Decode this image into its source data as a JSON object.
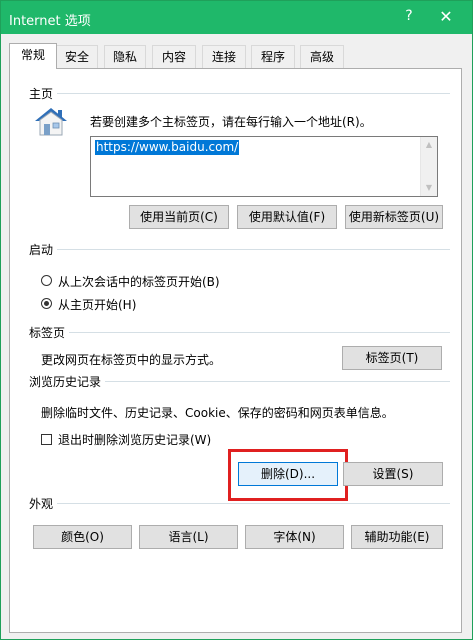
{
  "window": {
    "title": "Internet 选项",
    "help": "?",
    "close": "✕"
  },
  "tabs": [
    "常规",
    "安全",
    "隐私",
    "内容",
    "连接",
    "程序",
    "高级"
  ],
  "homepage": {
    "title": "主页",
    "description": "若要创建多个主标签页，请在每行输入一个地址(R)。",
    "url": "https://www.baidu.com/",
    "buttons": {
      "use_current": "使用当前页(C)",
      "use_default": "使用默认值(F)",
      "use_new_tab": "使用新标签页(U)"
    }
  },
  "startup": {
    "title": "启动",
    "options": [
      {
        "label": "从上次会话中的标签页开始(B)",
        "selected": false
      },
      {
        "label": "从主页开始(H)",
        "selected": true
      }
    ]
  },
  "tabs_group": {
    "title": "标签页",
    "description": "更改网页在标签页中的显示方式。",
    "button": "标签页(T)"
  },
  "history": {
    "title": "浏览历史记录",
    "description": "删除临时文件、历史记录、Cookie、保存的密码和网页表单信息。",
    "checkbox": "退出时删除浏览历史记录(W)",
    "delete_button": "删除(D)...",
    "settings_button": "设置(S)"
  },
  "appearance": {
    "title": "外观",
    "buttons": [
      "颜色(O)",
      "语言(L)",
      "字体(N)",
      "辅助功能(E)"
    ]
  },
  "colors": {
    "titlebar": "#1fb86a",
    "highlight": "#e02020",
    "selection": "#0078d7"
  }
}
